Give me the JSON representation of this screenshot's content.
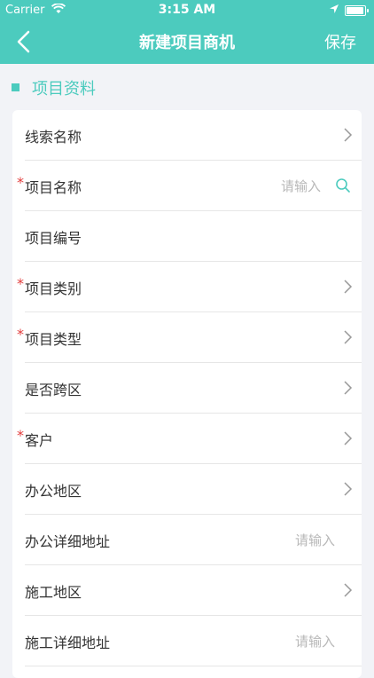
{
  "status_bar": {
    "carrier": "Carrier",
    "time": "3:15 AM",
    "battery_level": 0.95
  },
  "nav": {
    "back": "back-icon",
    "title": "新建项目商机",
    "save": "保存"
  },
  "section": {
    "title": "项目资料"
  },
  "colors": {
    "accent": "#4ccbbe",
    "required": "#e23b3b",
    "placeholder": "#b8b8b8",
    "text": "#333333"
  },
  "form": {
    "rows": [
      {
        "label": "线索名称",
        "required": false,
        "control": "chevron"
      },
      {
        "label": "项目名称",
        "required": true,
        "control": "search",
        "placeholder": "请输入"
      },
      {
        "label": "项目编号",
        "required": false,
        "control": "none"
      },
      {
        "label": "项目类别",
        "required": true,
        "control": "chevron"
      },
      {
        "label": "项目类型",
        "required": true,
        "control": "chevron"
      },
      {
        "label": "是否跨区",
        "required": false,
        "control": "chevron"
      },
      {
        "label": "客户",
        "required": true,
        "control": "chevron"
      },
      {
        "label": "办公地区",
        "required": false,
        "control": "chevron"
      },
      {
        "label": "办公详细地址",
        "required": false,
        "control": "input",
        "placeholder": "请输入"
      },
      {
        "label": "施工地区",
        "required": false,
        "control": "chevron"
      },
      {
        "label": "施工详细地址",
        "required": false,
        "control": "input",
        "placeholder": "请输入"
      }
    ]
  }
}
